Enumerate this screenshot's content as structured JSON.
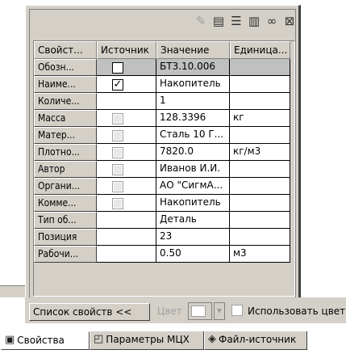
{
  "toolbar": {
    "icons": [
      "wand-icon",
      "document-icon",
      "list-icon",
      "book-icon",
      "link-icon",
      "properties-icon"
    ]
  },
  "grid": {
    "headers": [
      "Свойст...",
      "Источник",
      "Значение",
      "Единица..."
    ],
    "rows": [
      {
        "name": "Обозн...",
        "source": "unchecked",
        "value": "БТ3.10.006",
        "unit": ""
      },
      {
        "name": "Наиме...",
        "source": "checked",
        "value": "Накопитель",
        "unit": ""
      },
      {
        "name": "Количе...",
        "source": "none",
        "value": "1",
        "unit": ""
      },
      {
        "name": "Масса",
        "source": "disabled",
        "value": "128.3396",
        "unit": "кг"
      },
      {
        "name": "Матер...",
        "source": "disabled",
        "value": "Сталь 10  Г...",
        "unit": ""
      },
      {
        "name": "Плотно...",
        "source": "disabled",
        "value": "7820.0",
        "unit": "кг/м3"
      },
      {
        "name": "Автор",
        "source": "disabled",
        "value": "Иванов И.И.",
        "unit": ""
      },
      {
        "name": "Органи...",
        "source": "disabled",
        "value": "АО \"СигмА...",
        "unit": ""
      },
      {
        "name": "Комме...",
        "source": "disabled",
        "value": "Накопитель",
        "unit": ""
      },
      {
        "name": "Тип об...",
        "source": "none",
        "value": "Деталь",
        "unit": ""
      },
      {
        "name": "Позиция",
        "source": "none",
        "value": "23",
        "unit": ""
      },
      {
        "name": "Рабочи...",
        "source": "none",
        "value": "0.50",
        "unit": "м3"
      }
    ]
  },
  "bottom": {
    "list_button": "Список свойств  <<",
    "color_label": "Цвет",
    "use_color_label": "Использовать цвет"
  },
  "tabs": [
    {
      "label": "Свойства",
      "icon": "properties-tab-icon"
    },
    {
      "label": "Параметры МЦХ",
      "icon": "mass-properties-icon"
    },
    {
      "label": "Файл-источник",
      "icon": "source-file-icon"
    }
  ],
  "colors": {
    "panel": "#d4d0c8",
    "selected_row": "#c0c0c0"
  }
}
